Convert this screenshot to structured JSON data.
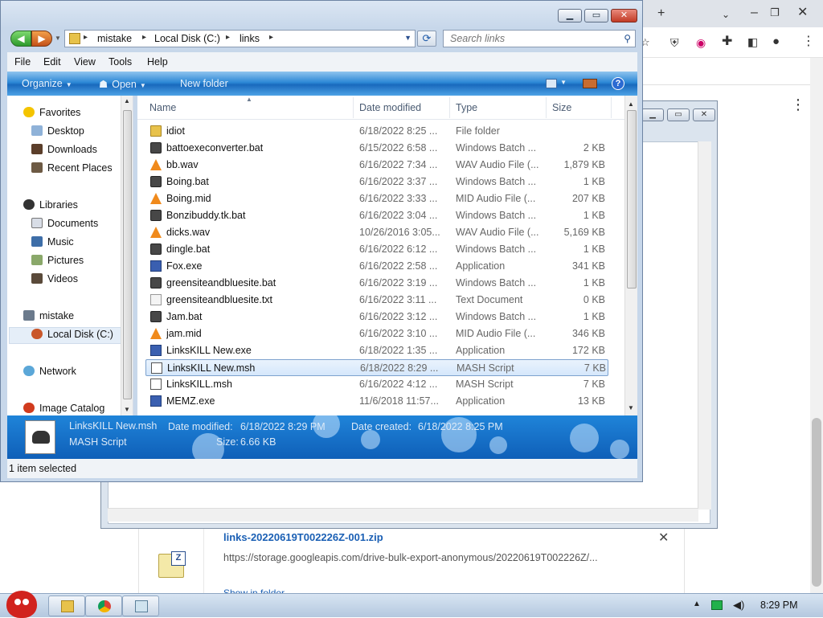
{
  "explorer": {
    "breadcrumb": [
      "mistake",
      "Local Disk (C:)",
      "links"
    ],
    "search_placeholder": "Search links",
    "menu": [
      "File",
      "Edit",
      "View",
      "Tools",
      "Help"
    ],
    "commands": {
      "organize": "Organize",
      "open": "Open",
      "new_folder": "New folder"
    },
    "columns": {
      "name": "Name",
      "date": "Date modified",
      "type": "Type",
      "size": "Size"
    },
    "nav": {
      "favorites": "Favorites",
      "favorite_items": [
        "Desktop",
        "Downloads",
        "Recent Places"
      ],
      "libraries": "Libraries",
      "library_items": [
        "Documents",
        "Music",
        "Pictures",
        "Videos"
      ],
      "computer": "mistake",
      "computer_items": [
        "Local Disk (C:)"
      ],
      "network": "Network",
      "extra": "Image Catalog"
    },
    "files": [
      {
        "name": "idiot",
        "date": "6/18/2022 8:25 ...",
        "type": "File folder",
        "size": "",
        "icon": "folder-icon"
      },
      {
        "name": "battoexeconverter.bat",
        "date": "6/15/2022 6:58 ...",
        "type": "Windows Batch ...",
        "size": "2 KB",
        "icon": "batch-file-icon"
      },
      {
        "name": "bb.wav",
        "date": "6/16/2022 7:34 ...",
        "type": "WAV Audio File (...",
        "size": "1,879 KB",
        "icon": "vlc-cone-icon"
      },
      {
        "name": "Boing.bat",
        "date": "6/16/2022 3:37 ...",
        "type": "Windows Batch ...",
        "size": "1 KB",
        "icon": "batch-file-icon"
      },
      {
        "name": "Boing.mid",
        "date": "6/16/2022 3:33 ...",
        "type": "MID Audio File (...",
        "size": "207 KB",
        "icon": "vlc-cone-icon"
      },
      {
        "name": "Bonzibuddy.tk.bat",
        "date": "6/16/2022 3:04 ...",
        "type": "Windows Batch ...",
        "size": "1 KB",
        "icon": "batch-file-icon"
      },
      {
        "name": "dicks.wav",
        "date": "10/26/2016 3:05...",
        "type": "WAV Audio File (...",
        "size": "5,169 KB",
        "icon": "vlc-cone-icon"
      },
      {
        "name": "dingle.bat",
        "date": "6/16/2022 6:12 ...",
        "type": "Windows Batch ...",
        "size": "1 KB",
        "icon": "batch-file-icon"
      },
      {
        "name": "Fox.exe",
        "date": "6/16/2022 2:58 ...",
        "type": "Application",
        "size": "341 KB",
        "icon": "application-icon"
      },
      {
        "name": "greensiteandbluesite.bat",
        "date": "6/16/2022 3:19 ...",
        "type": "Windows Batch ...",
        "size": "1 KB",
        "icon": "batch-file-icon"
      },
      {
        "name": "greensiteandbluesite.txt",
        "date": "6/16/2022 3:11 ...",
        "type": "Text Document",
        "size": "0 KB",
        "icon": "text-file-icon"
      },
      {
        "name": "Jam.bat",
        "date": "6/16/2022 3:12 ...",
        "type": "Windows Batch ...",
        "size": "1 KB",
        "icon": "batch-file-icon"
      },
      {
        "name": "jam.mid",
        "date": "6/16/2022 3:10 ...",
        "type": "MID Audio File (...",
        "size": "346 KB",
        "icon": "vlc-cone-icon"
      },
      {
        "name": "LinksKILL New.exe",
        "date": "6/18/2022 1:35 ...",
        "type": "Application",
        "size": "172 KB",
        "icon": "application-icon"
      },
      {
        "name": "LinksKILL New.msh",
        "date": "6/18/2022 8:29 ...",
        "type": "MASH Script",
        "size": "7 KB",
        "icon": "mash-script-icon",
        "selected": true
      },
      {
        "name": "LinksKILL.msh",
        "date": "6/16/2022 4:12 ...",
        "type": "MASH Script",
        "size": "7 KB",
        "icon": "mash-script-icon"
      },
      {
        "name": "MEMZ.exe",
        "date": "11/6/2018 11:57...",
        "type": "Application",
        "size": "13 KB",
        "icon": "application-icon"
      }
    ],
    "details": {
      "name": "LinksKILL New.msh",
      "type": "MASH Script",
      "date_modified_label": "Date modified:",
      "date_modified": "6/18/2022 8:29 PM",
      "date_created_label": "Date created:",
      "date_created": "6/18/2022 8:25 PM",
      "size_label": "Size:",
      "size": "6.66 KB"
    },
    "status": "1 item selected"
  },
  "download": {
    "filename": "links-20220619T002226Z-001.zip",
    "url": "https://storage.googleapis.com/drive-bulk-export-anonymous/20220619T002226Z/...",
    "show_in_folder": "Show in folder"
  },
  "taskbar": {
    "time": "8:29 PM"
  }
}
